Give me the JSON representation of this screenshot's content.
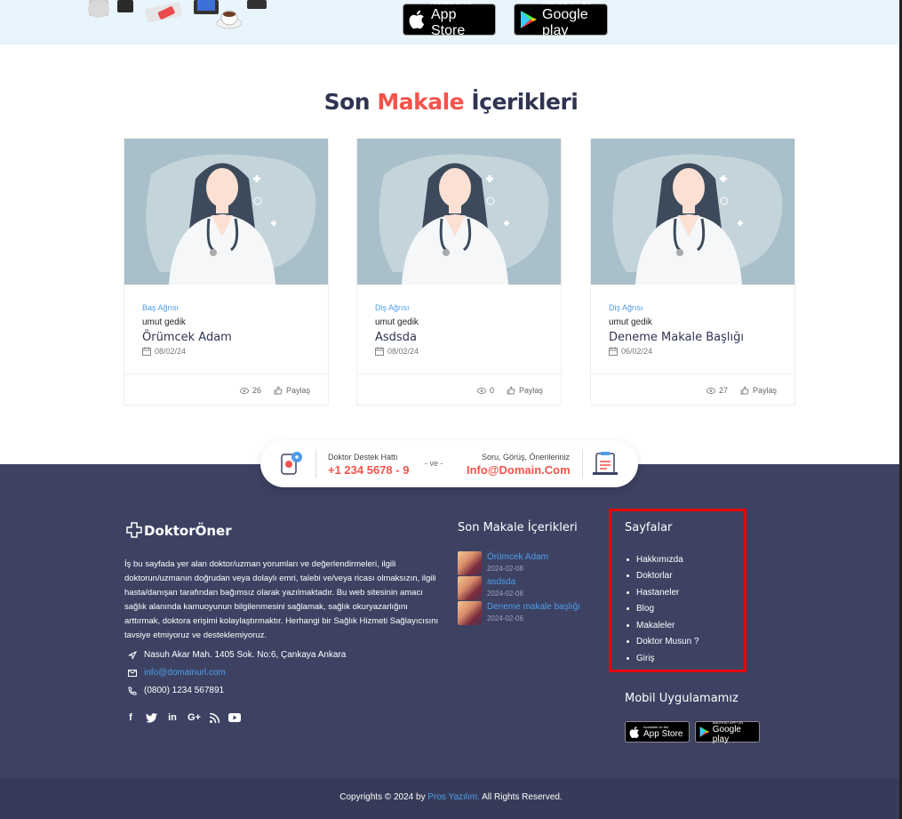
{
  "banner": {
    "appstore_small": "Available on the",
    "appstore_big": "App Store",
    "googleplay_small": "ANDROID APP ON",
    "googleplay_big": "Google play"
  },
  "section": {
    "title_part1": "Son",
    "title_accent": "Makale",
    "title_part2": "İçerikleri",
    "accent_color": "#f4534b"
  },
  "cards": [
    {
      "category": "Baş Ağrısı",
      "author": "umut gedik",
      "title": "Örümcek Adam",
      "date": "08/02/24",
      "views": "26",
      "share": "Paylaş"
    },
    {
      "category": "Diş Ağrısı",
      "author": "umut gedik",
      "title": "Asdsda",
      "date": "08/02/24",
      "views": "0",
      "share": "Paylaş"
    },
    {
      "category": "Diş Ağrısı",
      "author": "umut gedik",
      "title": "Deneme Makale Başlığı",
      "date": "06/02/24",
      "views": "27",
      "share": "Paylaş"
    }
  ],
  "contact": {
    "hotline_label": "Doktor Destek Hattı",
    "hotline_value": "+1 234 5678 - 9",
    "and": "- ve -",
    "feedback_label": "Soru, Görüş, Önerileriniz",
    "feedback_value": "Info@Domain.Com"
  },
  "footer": {
    "logo_text": "DoktorÖner",
    "about": "İş bu sayfada yer alan doktor/uzman yorumları ve değerlendirmeleri, ilgili doktorun/uzmanın doğrudan veya dolaylı emri, talebi ve/veya ricası olmaksızın, ilgili hasta/danışan tarafından bağımsız olarak yazılmaktadır. Bu web sitesinin amacı sağlık alanında kamuoyunun bilgilenmesini sağlamak, sağlık okuryazarlığını arttırmak, doktora erişimi kolaylaştırmaktır. Herhangi bir Sağlık Hizmeti Sağlayıcısını tavsiye etmiyoruz ve desteklemiyoruz.",
    "address": "Nasuh Akar Mah. 1405 Sok. No:6, Çankaya Ankara",
    "email": "info@domainurl.com",
    "phone": "(0800) 1234 567891",
    "social": [
      "f",
      "t",
      "in",
      "G+",
      "rss",
      "yt"
    ],
    "recent_title": "Son Makale İçerikleri",
    "recent": [
      {
        "title": "Örümcek Adam",
        "date": "2024-02-08"
      },
      {
        "title": "asdsda",
        "date": "2024-02-08"
      },
      {
        "title": "Deneme makale başlığı",
        "date": "2024-02-06"
      }
    ],
    "pages_title": "Sayfalar",
    "pages": [
      "Hakkımızda",
      "Doktorlar",
      "Hastaneler",
      "Blog",
      "Makaleler",
      "Doktor Musun ?",
      "Giriş"
    ],
    "mobile_title": "Mobil Uygulamamız",
    "copyright_pre": "Copyrights © 2024 by",
    "copyright_link": "Pros Yazılım.",
    "copyright_post": "All Rights Reserved."
  }
}
